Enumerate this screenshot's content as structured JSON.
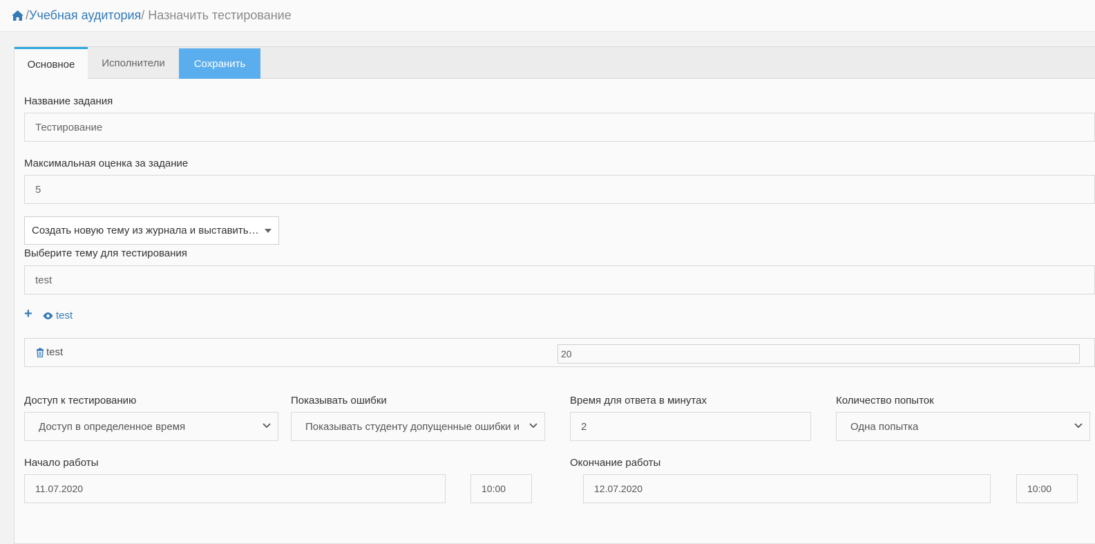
{
  "breadcrumb": {
    "home_icon": "home-icon",
    "sep1": "/",
    "classroom": "Учебная аудитория",
    "sep2": "/",
    "current": "Назначить тестирование"
  },
  "tabs": {
    "main": "Основное",
    "performers": "Исполнители",
    "save": "Сохранить"
  },
  "form": {
    "task_name_label": "Название задания",
    "task_name_value": "Тестирование",
    "max_grade_label": "Максимальная оценка за задание",
    "max_grade_value": "5",
    "topic_mode_select": "Создать новую тему из журнала и выставить…",
    "topic_label": "Выберите тему для тестирования",
    "topic_value": "test",
    "add_icon": "plus-icon",
    "view_icon": "eye-icon",
    "view_link": "test",
    "row_delete_icon": "trash-icon",
    "row_name": "test",
    "row_count": "20",
    "access_label": "Доступ к тестированию",
    "access_value": "Доступ в определенное время",
    "errors_label": "Показывать ошибки",
    "errors_value": "Показывать студенту допущенные ошибки и",
    "time_label": "Время для ответа в минутах",
    "time_value": "2",
    "attempts_label": "Количество попыток",
    "attempts_value": "Одна попытка",
    "start_label": "Начало работы",
    "start_date": "11.07.2020",
    "start_time": "10:00",
    "end_label": "Окончание работы",
    "end_date": "12.07.2020",
    "end_time": "10:00"
  },
  "colors": {
    "accent": "#337ab7",
    "save_button": "#5baeed",
    "active_tab_border": "#2aa6de"
  }
}
